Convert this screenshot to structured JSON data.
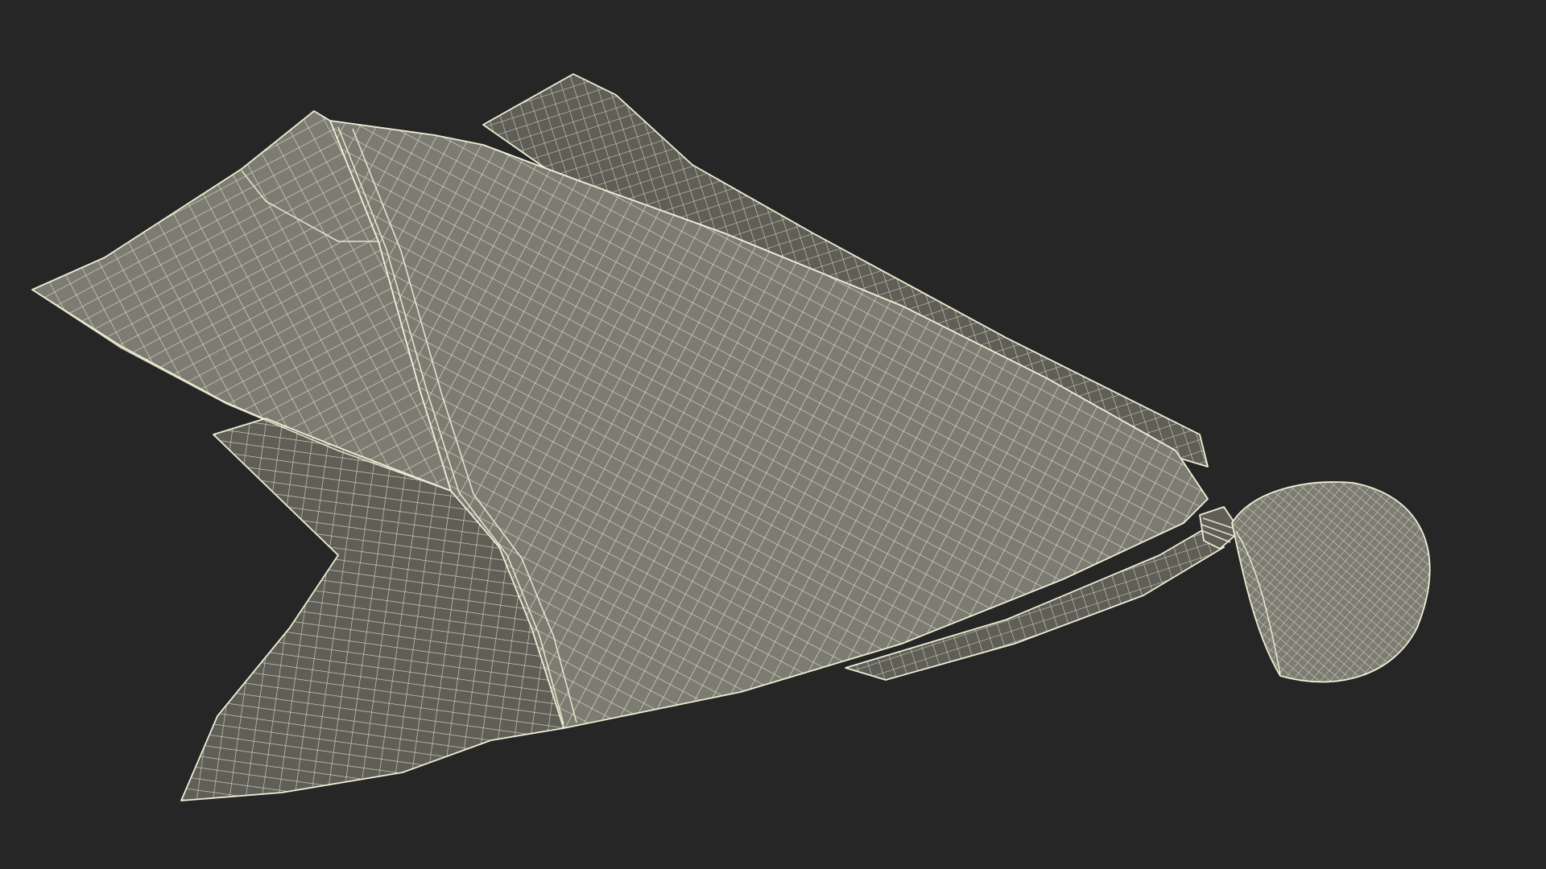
{
  "scene": {
    "background_color": "#262626",
    "surface_color": "#7c7c72",
    "surface_shadow_color": "#5f5f57",
    "wire_color": "#eeeed6",
    "object": "penalty-flag-wireframe"
  }
}
